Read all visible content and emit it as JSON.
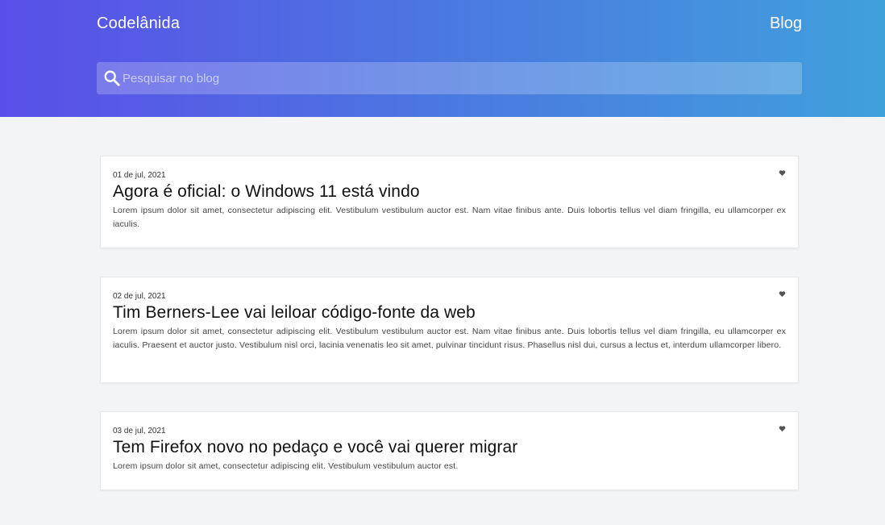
{
  "header": {
    "brand": "Codelânida",
    "nav_blog": "Blog",
    "search_placeholder": "Pesquisar no blog",
    "gradient_start": "#5a4ee8",
    "gradient_end": "#40a0dc"
  },
  "posts": [
    {
      "date": "01 de jul, 2021",
      "title": "Agora é oficial: o Windows 11 está vindo",
      "excerpt": "Lorem ipsum dolor sit amet, consectetur adipiscing elit. Vestibulum vestibulum auctor est. Nam vitae finibus ante. Duis lobortis tellus vel diam fringilla, eu ullamcorper ex iaculis."
    },
    {
      "date": "02 de jul, 2021",
      "title": "Tim Berners-Lee vai leiloar código-fonte da web",
      "excerpt": "Lorem ipsum dolor sit amet, consectetur adipiscing elit. Vestibulum vestibulum auctor est. Nam vitae finibus ante. Duis lobortis tellus vel diam fringilla, eu ullamcorper ex iaculis. Praesent et auctor justo. Vestibulum nisl orci, lacinia venenatis leo sit amet, pulvinar tincidunt risus. Phasellus nisl dui, cursus a lectus et, interdum ullamcorper libero."
    },
    {
      "date": "03 de jul, 2021",
      "title": "Tem Firefox novo no pedaço e você vai querer migrar",
      "excerpt": "Lorem ipsum dolor sit amet, consectetur adipiscing elit. Vestibulum vestibulum auctor est."
    }
  ],
  "icons": {
    "search": "search-icon",
    "heart": "heart-icon"
  }
}
